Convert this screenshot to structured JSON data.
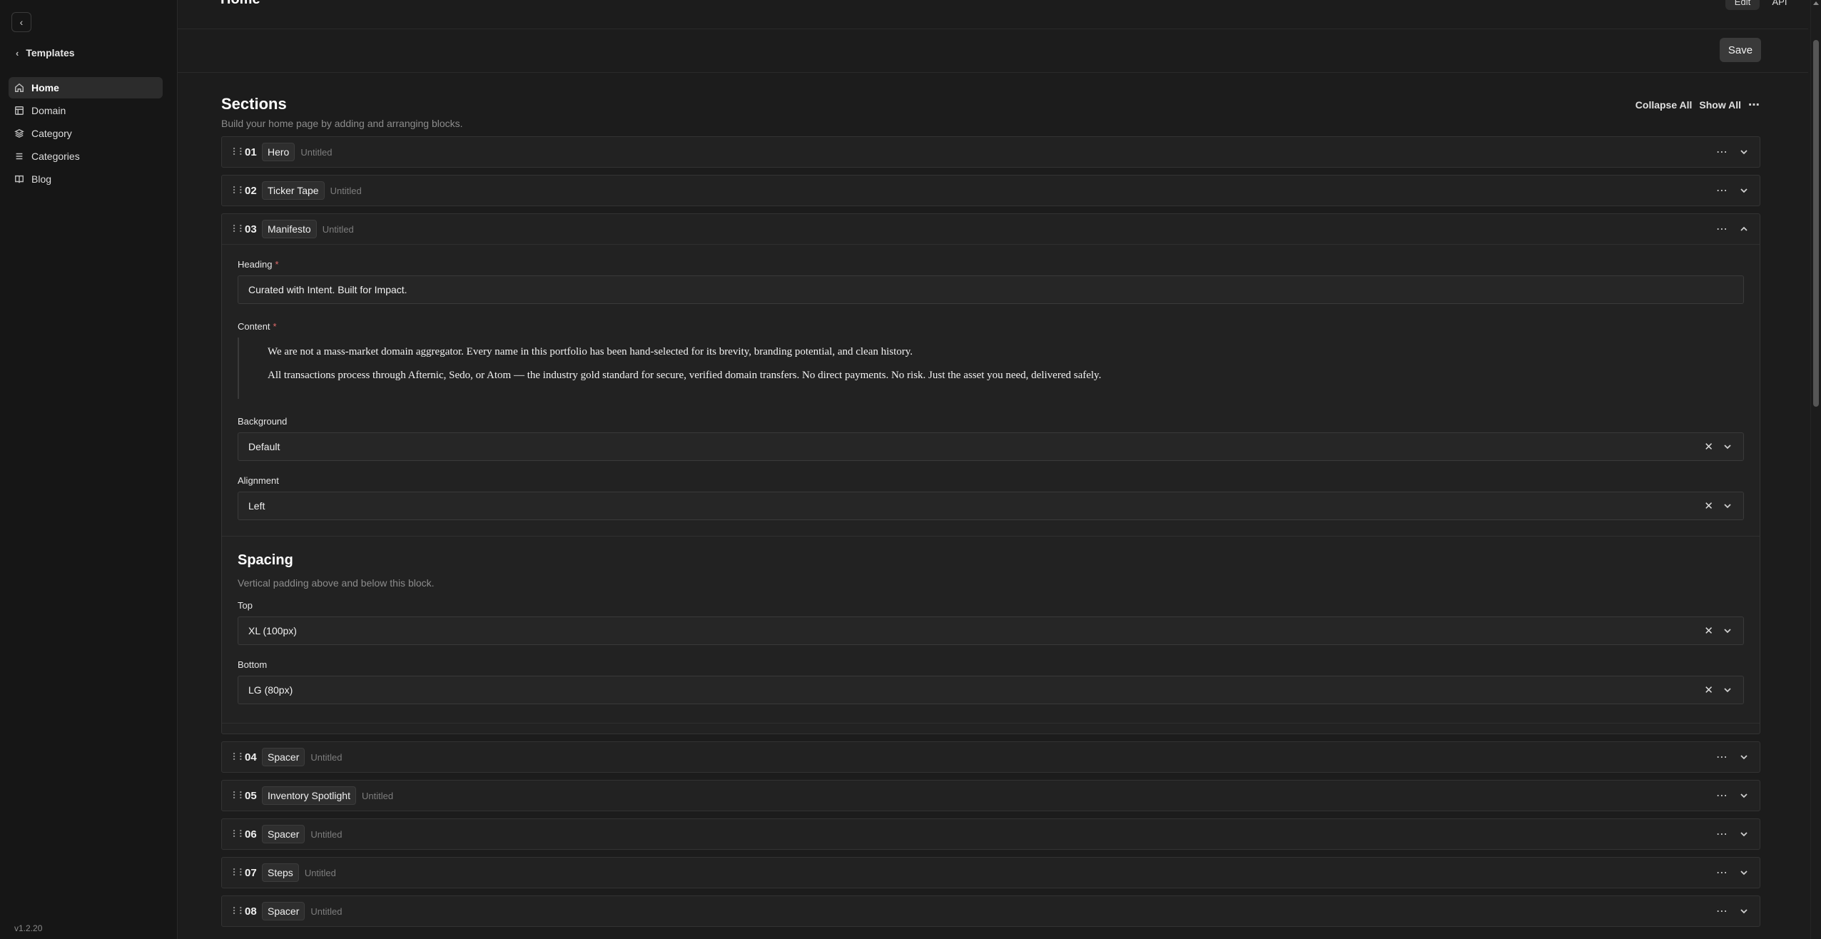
{
  "app": {
    "page_title": "Home",
    "top_actions": [
      "Edit",
      "API"
    ],
    "save_label": "Save",
    "version": "v1.2.20"
  },
  "sidebar": {
    "back_label": "Templates",
    "items": [
      {
        "label": "Home",
        "icon": "home-icon",
        "active": true
      },
      {
        "label": "Domain",
        "icon": "layout-icon",
        "active": false
      },
      {
        "label": "Category",
        "icon": "layers-icon",
        "active": false
      },
      {
        "label": "Categories",
        "icon": "list-icon",
        "active": false
      },
      {
        "label": "Blog",
        "icon": "book-icon",
        "active": false
      }
    ]
  },
  "sections": {
    "title": "Sections",
    "subtitle": "Build your home page by adding and arranging blocks.",
    "collapse_all": "Collapse All",
    "show_all": "Show All",
    "blocks": [
      {
        "num": "01",
        "type": "Hero",
        "name": "Untitled"
      },
      {
        "num": "02",
        "type": "Ticker Tape",
        "name": "Untitled"
      },
      {
        "num": "03",
        "type": "Manifesto",
        "name": "Untitled"
      },
      {
        "num": "04",
        "type": "Spacer",
        "name": "Untitled"
      },
      {
        "num": "05",
        "type": "Inventory Spotlight",
        "name": "Untitled"
      },
      {
        "num": "06",
        "type": "Spacer",
        "name": "Untitled"
      },
      {
        "num": "07",
        "type": "Steps",
        "name": "Untitled"
      },
      {
        "num": "08",
        "type": "Spacer",
        "name": "Untitled"
      }
    ]
  },
  "manifesto": {
    "heading_label": "Heading",
    "heading_value": "Curated with Intent. Built for Impact.",
    "content_label": "Content",
    "content_p1": "We are not a mass-market domain aggregator. Every name in this portfolio has been hand-selected for its brevity, branding potential, and clean history.",
    "content_p2": "All transactions process through Afternic, Sedo, or Atom — the industry gold standard for secure, verified domain transfers. No direct payments. No risk. Just the asset you need, delivered safely.",
    "background_label": "Background",
    "background_value": "Default",
    "alignment_label": "Alignment",
    "alignment_value": "Left",
    "spacing_title": "Spacing",
    "spacing_sub": "Vertical padding above and below this block.",
    "top_label": "Top",
    "top_value": "XL (100px)",
    "bottom_label": "Bottom",
    "bottom_value": "LG (80px)"
  }
}
